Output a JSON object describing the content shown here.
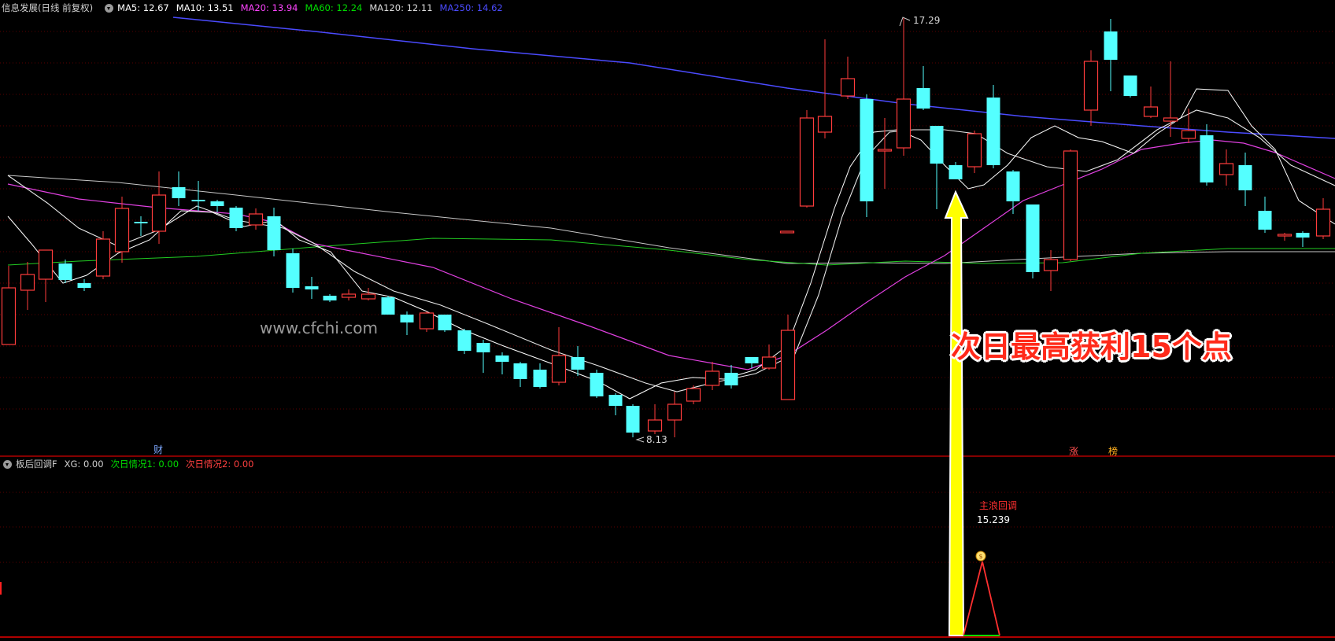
{
  "main_legend": {
    "stock_name": "信息发展",
    "mode": "(日线 前复权)",
    "ma5": "MA5: 12.67",
    "ma10": "MA10: 13.51",
    "ma20": "MA20: 13.94",
    "ma60": "MA60: 12.24",
    "ma120": "MA120: 12.11",
    "ma250": "MA250: 14.62"
  },
  "colors": {
    "ma5": "#ffffff",
    "ma10": "#f0f0f0",
    "ma20": "#ff44ff",
    "ma60": "#00dd00",
    "ma120": "#dddddd",
    "ma250": "#4b4bff",
    "up": "#ff3c3c",
    "down": "#54ffff",
    "arrow": "#ffff00",
    "signal": "#ff3030"
  },
  "sub_legend": {
    "indicator": "板后回调F",
    "xg": "XG: 0.00",
    "case1": "次日情况1: 0.00",
    "case2": "次日情况2: 0.00"
  },
  "price_marks": {
    "high_label": "17.29",
    "low_label": "8.13"
  },
  "flags": {
    "cai": "财",
    "zhang": "涨",
    "bang": "榜"
  },
  "watermark": "www.cfchi.com",
  "annotation": "次日最高获利15个点",
  "signal": {
    "title": "主浪回调",
    "value": "15.239",
    "bag_icon": "money-bag-icon"
  },
  "chart_data": {
    "type": "candlestick",
    "series": [
      {
        "name": "MA5"
      },
      {
        "name": "MA10"
      },
      {
        "name": "MA20"
      },
      {
        "name": "MA60"
      },
      {
        "name": "MA120"
      },
      {
        "name": "MA250"
      }
    ],
    "high": 17.29,
    "low": 8.13,
    "signal_value": 15.239
  }
}
